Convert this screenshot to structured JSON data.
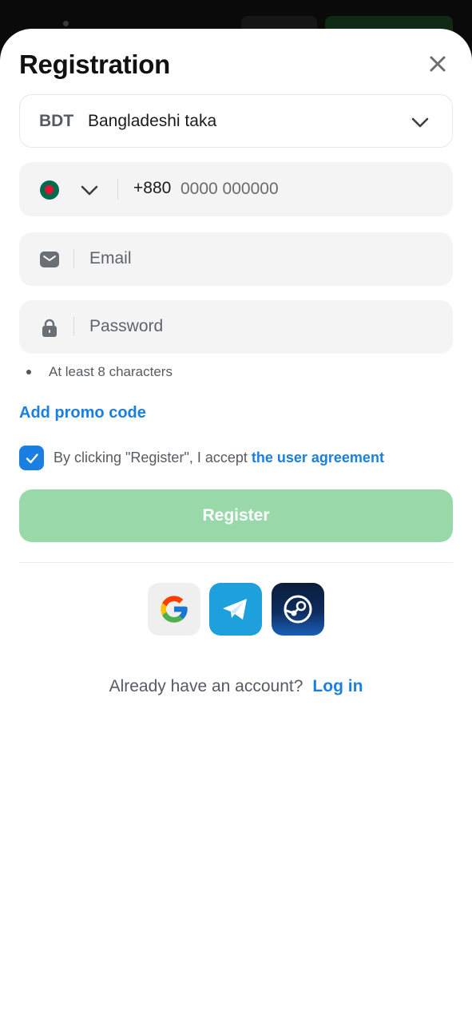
{
  "title": "Registration",
  "currency": {
    "code": "BDT",
    "name": "Bangladeshi taka"
  },
  "phone": {
    "prefix": "+880",
    "placeholder": "0000 000000"
  },
  "email": {
    "placeholder": "Email"
  },
  "password": {
    "placeholder": "Password",
    "hint": "At least 8 characters"
  },
  "promo_label": "Add promo code",
  "agreement": {
    "checked": true,
    "text": "By clicking \"Register\", I accept",
    "link": "the user agreement"
  },
  "register_label": "Register",
  "social": [
    "google-icon",
    "telegram-icon",
    "steam-icon"
  ],
  "login": {
    "question": "Already have an account?",
    "link": "Log in"
  },
  "colors": {
    "accent": "#1a7fe0",
    "register_disabled": "#99d9a9"
  }
}
